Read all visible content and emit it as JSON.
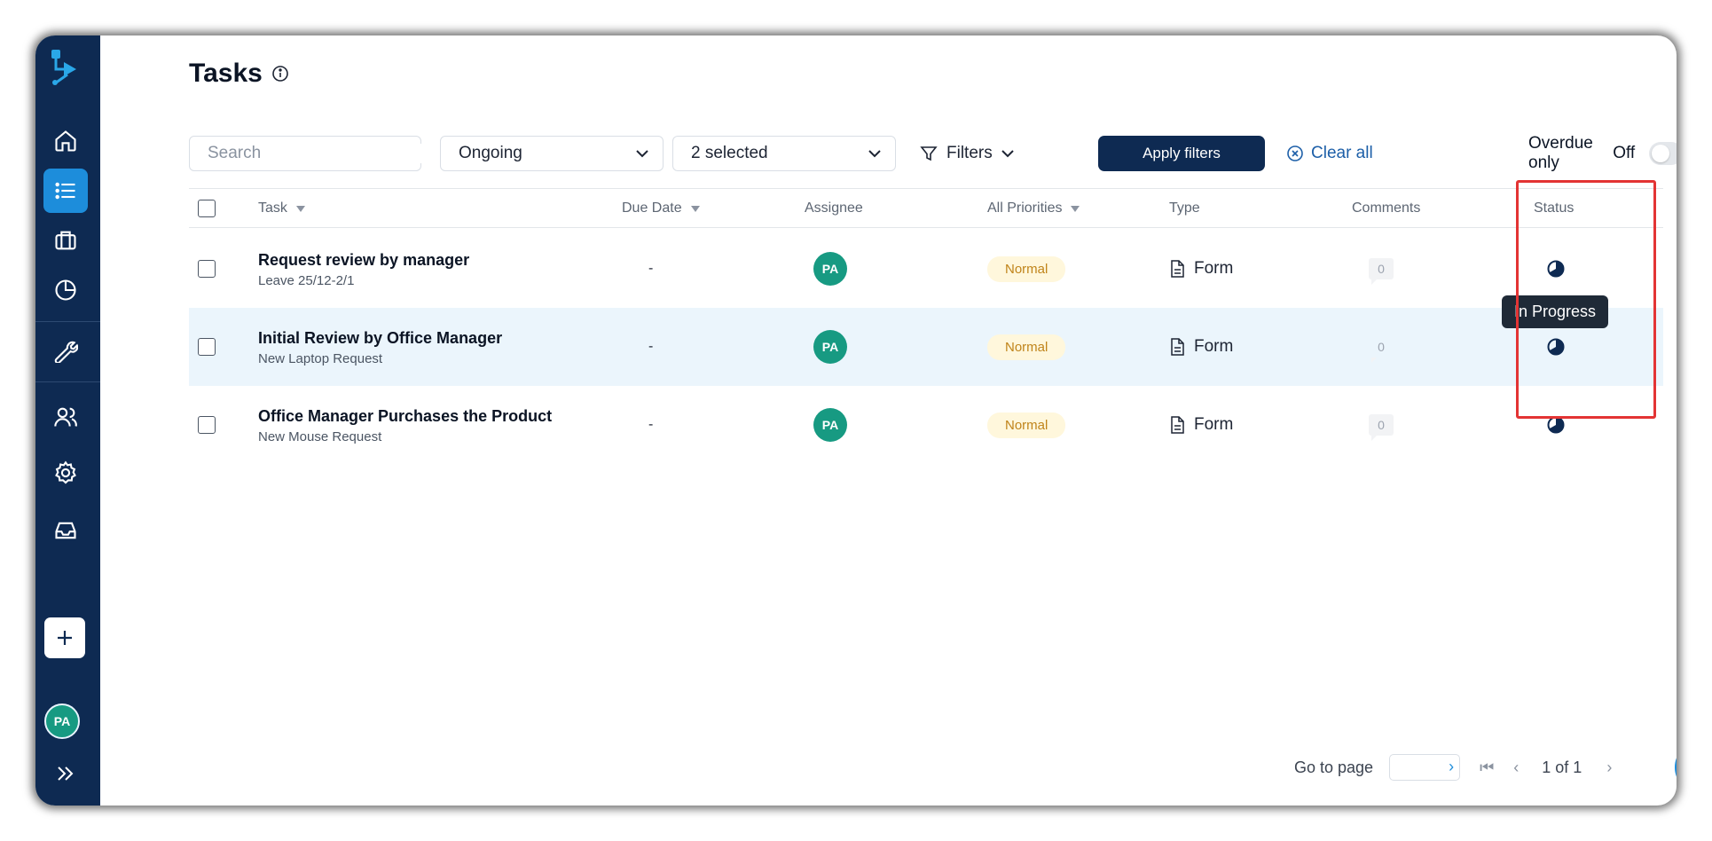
{
  "page": {
    "title": "Tasks"
  },
  "sidebar": {
    "items": [
      {
        "name": "home",
        "icon": "home-icon"
      },
      {
        "name": "tasks",
        "icon": "list-icon",
        "active": true
      },
      {
        "name": "briefcase",
        "icon": "briefcase-icon"
      },
      {
        "name": "reports",
        "icon": "pie-chart-icon"
      },
      {
        "name": "tools",
        "icon": "wrench-icon"
      },
      {
        "name": "users",
        "icon": "users-icon"
      },
      {
        "name": "settings",
        "icon": "gear-icon"
      },
      {
        "name": "inbox",
        "icon": "inbox-icon"
      }
    ],
    "avatar_initials": "PA"
  },
  "toolbar": {
    "search_placeholder": "Search",
    "status_select": "Ongoing",
    "multi_select": "2 selected",
    "filters_label": "Filters",
    "apply_label": "Apply filters",
    "clear_label": "Clear all",
    "overdue_label": "Overdue only",
    "overdue_state": "Off"
  },
  "table": {
    "headers": {
      "task": "Task",
      "due_date": "Due Date",
      "assignee": "Assignee",
      "priority": "All Priorities",
      "type": "Type",
      "comments": "Comments",
      "status": "Status"
    },
    "rows": [
      {
        "title": "Request review by manager",
        "subtitle": "Leave 25/12-2/1",
        "due": "-",
        "assignee": "PA",
        "priority": "Normal",
        "type": "Form",
        "comments": "0"
      },
      {
        "title": "Initial Review by Office Manager",
        "subtitle": "New Laptop Request",
        "due": "-",
        "assignee": "PA",
        "priority": "Normal",
        "type": "Form",
        "comments": "0"
      },
      {
        "title": "Office Manager Purchases the Product",
        "subtitle": "New Mouse Request",
        "due": "-",
        "assignee": "PA",
        "priority": "Normal",
        "type": "Form",
        "comments": "0"
      }
    ]
  },
  "tooltip": "In Progress",
  "pagination": {
    "go_to_label": "Go to page",
    "page_info": "1 of 1"
  },
  "colors": {
    "sidebar": "#0e2a52",
    "accent": "#1d8ddb",
    "avatar": "#179a82",
    "highlight": "#e33434"
  }
}
